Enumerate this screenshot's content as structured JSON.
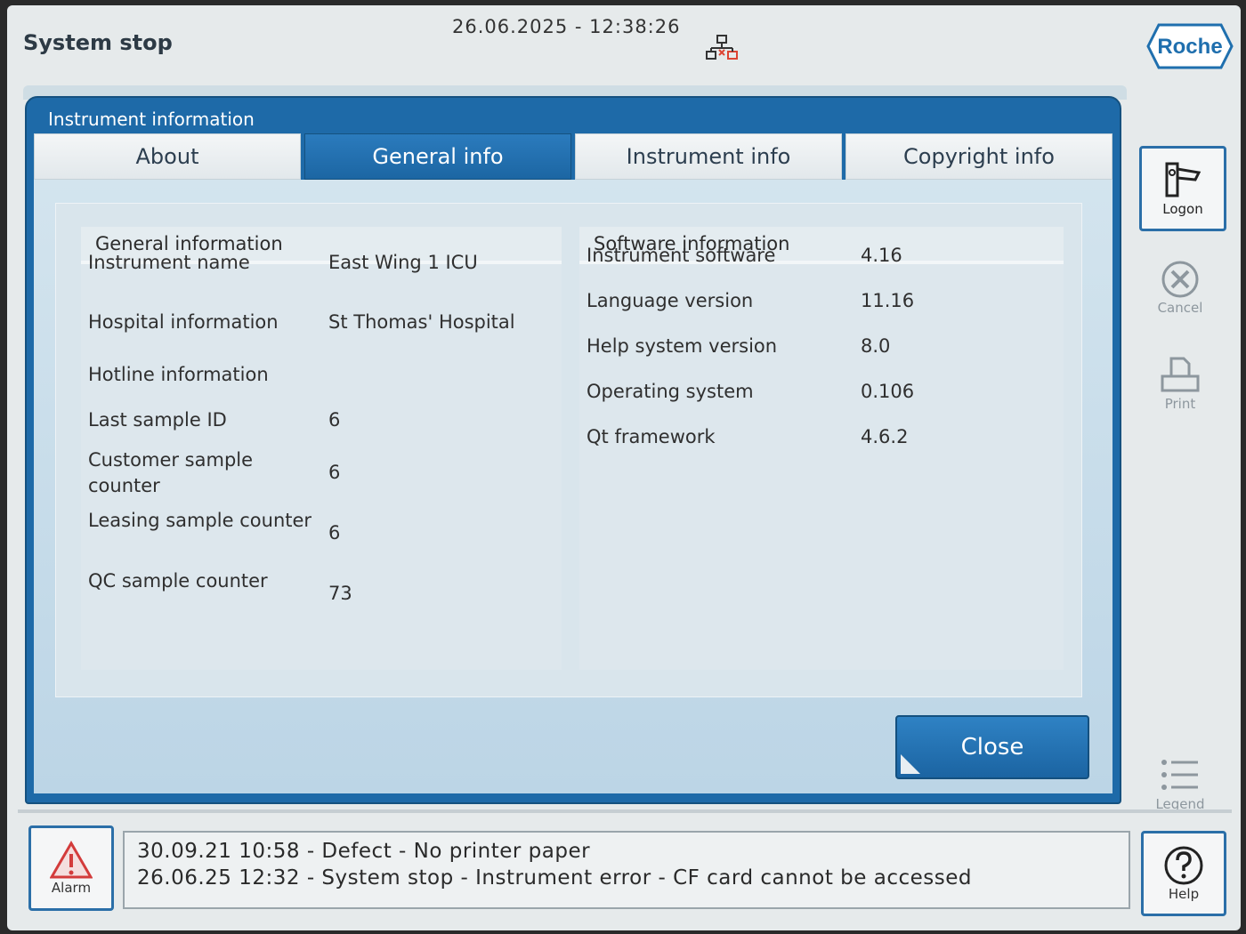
{
  "header": {
    "status": "System stop",
    "datetime": "26.06.2025 - 12:38:26",
    "brand": "Roche"
  },
  "dialog": {
    "title": "Instrument information",
    "tabs": [
      "About",
      "General info",
      "Instrument info",
      "Copyright info"
    ],
    "active_tab": "General info",
    "general": {
      "heading": "General information",
      "rows": [
        {
          "label": "Instrument name",
          "value": "East Wing 1 ICU"
        },
        {
          "label": "Hospital information",
          "value": "St Thomas' Hospital"
        },
        {
          "label": "Hotline information",
          "value": ""
        },
        {
          "label": "Last sample ID",
          "value": "6"
        },
        {
          "label": "Customer sample counter",
          "value": "6"
        },
        {
          "label": "Leasing sample counter",
          "value": "6"
        },
        {
          "label": "QC sample counter",
          "value": "73"
        }
      ]
    },
    "software": {
      "heading": "Software information",
      "rows": [
        {
          "label": "Instrument software",
          "value": "4.16"
        },
        {
          "label": "Language version",
          "value": "11.16"
        },
        {
          "label": "Help system version",
          "value": "8.0"
        },
        {
          "label": "Operating system",
          "value": "0.106"
        },
        {
          "label": "Qt framework",
          "value": "4.6.2"
        }
      ]
    },
    "close_label": "Close"
  },
  "sidebar": {
    "logon": "Logon",
    "cancel": "Cancel",
    "print": "Print",
    "legend": "Legend",
    "help": "Help"
  },
  "footer": {
    "alarm": "Alarm",
    "messages": [
      "30.09.21 10:58 - Defect - No printer paper",
      "26.06.25 12:32 - System stop - Instrument error - CF card cannot be accessed"
    ]
  },
  "colors": {
    "accent": "#1e6aa8",
    "alarm": "#d33b3b"
  }
}
